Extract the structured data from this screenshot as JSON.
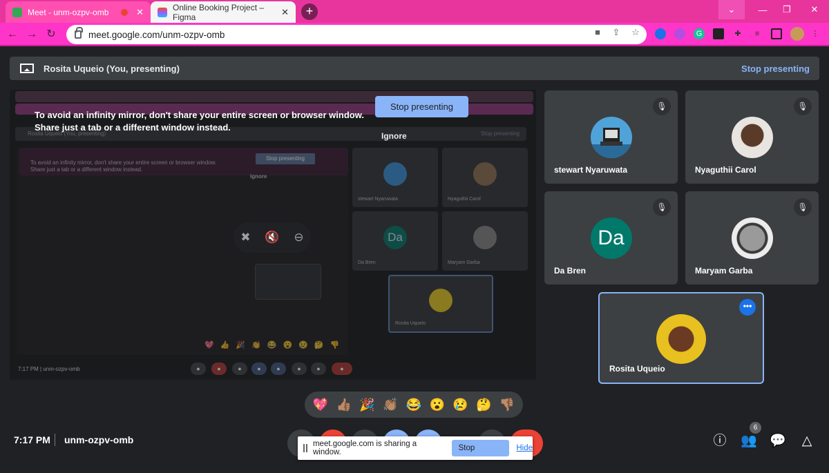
{
  "browser": {
    "tabs": [
      {
        "title": "Meet - unm-ozpv-omb"
      },
      {
        "title": "Online Booking Project – Figma"
      }
    ],
    "new_tab_label": "+",
    "url": "meet.google.com/unm-ozpv-omb"
  },
  "presenting_bar": {
    "text": "Rosita Uqueio (You, presenting)",
    "stop_link": "Stop presenting"
  },
  "mirror": {
    "warning_line1": "To avoid an infinity mirror, don't share your entire screen or browser window.",
    "warning_line2": "Share just a tab or a different window instead.",
    "stop_button": "Stop presenting",
    "ignore": "Ignore",
    "mini_tiles": [
      {
        "name": "stewart Nyaruwata"
      },
      {
        "name": "Nyaguthii Carol"
      },
      {
        "name": "Da Bren",
        "initials": "Da"
      },
      {
        "name": "Maryam Garba"
      },
      {
        "name": "Rosita Uqueio"
      }
    ],
    "mini_clock": "7:17 PM",
    "mini_code": "unm-ozpv-omb",
    "mini_presenting": "Stop presenting",
    "mini_title": "Rosita Uqueio (You, presenting)",
    "mini_warning_line1": "To avoid an infinity mirror, don't share your entire screen or browser window.",
    "mini_warning_line2": "Share just a tab or a different window instead.",
    "mini_stop": "Stop presenting",
    "mini_ignore": "Ignore"
  },
  "participants": [
    {
      "name": "stewart Nyaruwata",
      "avatar": "pixel-computer-avatar"
    },
    {
      "name": "Nyaguthii Carol",
      "avatar": "photo"
    },
    {
      "name": "Da Bren",
      "initials": "Da",
      "color": "#00796b"
    },
    {
      "name": "Maryam Garba",
      "avatar": "photo"
    },
    {
      "name": "Rosita Uqueio",
      "avatar": "photo",
      "active": true
    }
  ],
  "reactions": [
    "💖",
    "👍🏽",
    "🎉",
    "👏🏽",
    "😂",
    "😮",
    "😢",
    "🤔",
    "👎🏽"
  ],
  "bottom": {
    "clock": "7:17 PM",
    "meeting_code": "unm-ozpv-omb",
    "people_count": "6"
  },
  "share_notice": {
    "text": "meet.google.com is sharing a window.",
    "stop": "Stop sharing",
    "hide": "Hide"
  },
  "colors": {
    "accent": "#8ab4f8",
    "active_blue": "#1a73e8",
    "tab_pink": "#e8359e"
  }
}
